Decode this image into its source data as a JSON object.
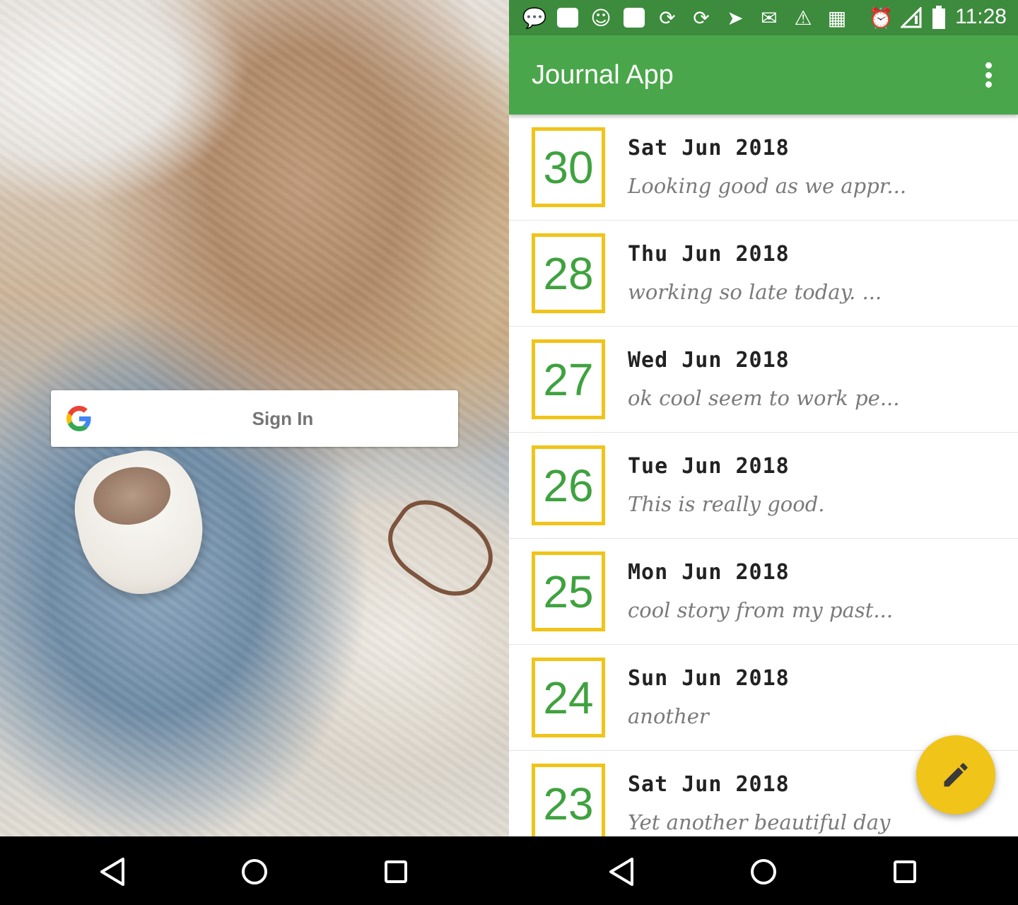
{
  "left_screen": {
    "signin": {
      "label": "Sign In",
      "icon": "google-g-icon"
    }
  },
  "right_screen": {
    "status_bar": {
      "time": "11:28",
      "icons": [
        "chat-icon",
        "message-icon",
        "sms-icon",
        "square-icon",
        "sync-icon",
        "sync-icon",
        "navigation-icon",
        "gmail-icon",
        "warning-icon",
        "winrar-icon",
        "alarm-icon",
        "signal-icon",
        "battery-icon"
      ],
      "background": "#3d8b3d"
    },
    "app_bar": {
      "title": "Journal App",
      "background": "#4aa64a"
    },
    "entries": [
      {
        "day": "30",
        "date": "Sat Jun 2018",
        "snippet": "Looking good as we appr..."
      },
      {
        "day": "28",
        "date": "Thu Jun 2018",
        "snippet": "working so late today. ..."
      },
      {
        "day": "27",
        "date": "Wed Jun 2018",
        "snippet": "ok cool seem to work pe..."
      },
      {
        "day": "26",
        "date": "Tue Jun 2018",
        "snippet": "This is really good."
      },
      {
        "day": "25",
        "date": "Mon Jun 2018",
        "snippet": "cool story from my past..."
      },
      {
        "day": "24",
        "date": "Sun Jun 2018",
        "snippet": "another"
      },
      {
        "day": "23",
        "date": "Sat Jun 2018",
        "snippet": "Yet another beautiful day"
      }
    ],
    "fab": {
      "icon": "edit-pencil-icon",
      "color": "#f0c419"
    },
    "colors": {
      "date_number": "#3fa23f",
      "date_border": "#f0c419"
    }
  },
  "nav_bar": {
    "icons": [
      "back-icon",
      "home-icon",
      "recents-icon"
    ]
  }
}
